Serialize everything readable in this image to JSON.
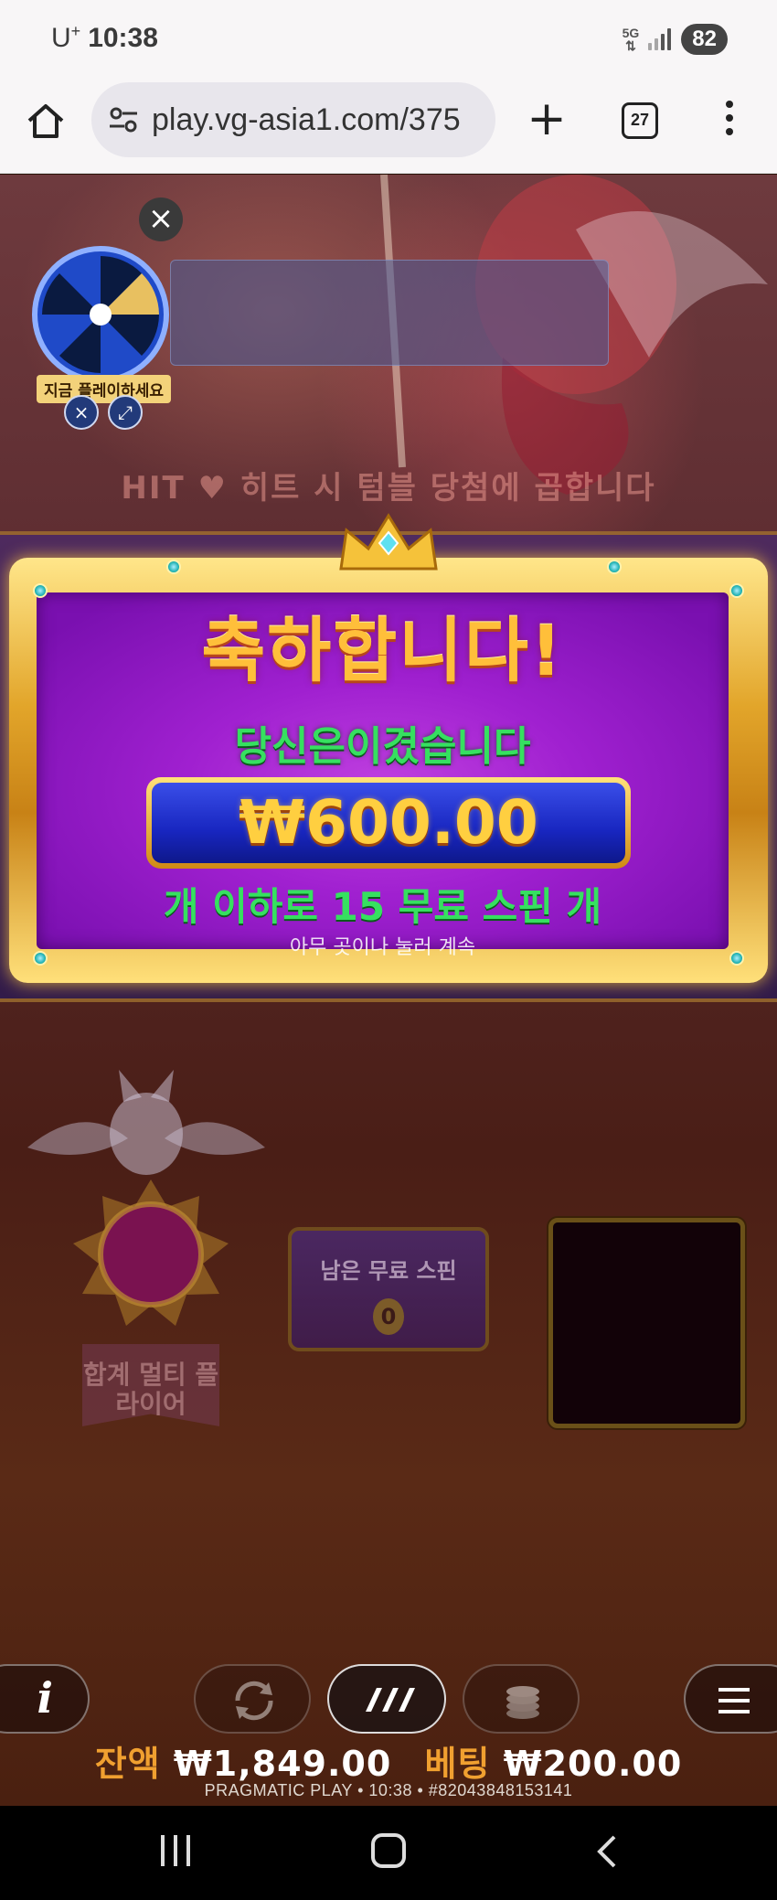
{
  "status_bar": {
    "carrier": "U",
    "carrier_sup": "+",
    "time": "10:38",
    "network": "5G",
    "battery": "82"
  },
  "browser": {
    "url": "play.vg-asia1.com/375",
    "tab_count": "27"
  },
  "promo": {
    "play_now": "지금 플레이하세요"
  },
  "game": {
    "hit_banner": "HIT ♥ 히트 시 텀블 당첨에 곱합니다",
    "win_popup": {
      "title": "축하합니다!",
      "subtitle": "당신은이겼습니다",
      "amount": "₩600.00",
      "free_spins": "개 이하로 15 무료 스핀 개",
      "hint": "아무 곳이나 눌러 계속"
    },
    "multiplier_flyer_label": "합계 멀티 플라이어",
    "remaining_free_spins_label": "남은 무료 스핀",
    "remaining_free_spins_value": "0"
  },
  "footer": {
    "balance_label": "잔액",
    "balance_value": "₩1,849.00",
    "bet_label": "베팅",
    "bet_value": "₩200.00",
    "info_line": "PRAGMATIC PLAY • 10:38 • #82043848153141"
  },
  "colors": {
    "gold": "#f0a030",
    "green_text": "#36e060",
    "popup_purple": "#a020d0",
    "amount_blue": "#1826c0"
  }
}
